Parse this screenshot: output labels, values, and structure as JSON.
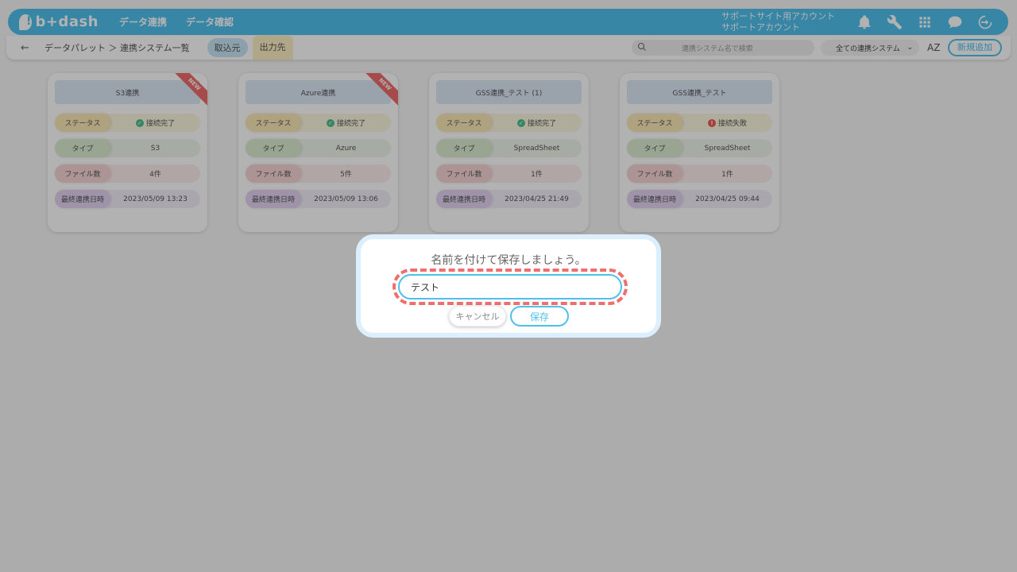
{
  "header": {
    "logo_text": "b+dash",
    "nav": [
      "データ連携",
      "データ確認"
    ],
    "account_line1": "サポートサイト用アカウント",
    "account_line2": "サポートアカウント",
    "accent_color": "#4fc0ee"
  },
  "subbar": {
    "back_icon": "←",
    "breadcrumb": "データパレット ＞ 連携システム一覧",
    "tab_source": "取込元",
    "tab_dest": "出力先",
    "search_placeholder": "連携システム名で検索",
    "filter_selected": "全ての連携システム",
    "sort_label": "AZ",
    "new_button": "新規追加"
  },
  "cards": [
    {
      "title": "S3連携",
      "badge": "NEW",
      "status_label": "ステータス",
      "status": "接続完了",
      "status_ok": true,
      "type_label": "タイプ",
      "type": "S3",
      "files_label": "ファイル数",
      "files": "4件",
      "date_label": "最終連携日時",
      "date": "2023/05/09 13:23"
    },
    {
      "title": "Azure連携",
      "badge": "NEW",
      "status_label": "ステータス",
      "status": "接続完了",
      "status_ok": true,
      "type_label": "タイプ",
      "type": "Azure",
      "files_label": "ファイル数",
      "files": "5件",
      "date_label": "最終連携日時",
      "date": "2023/05/09 13:06"
    },
    {
      "title": "GSS連携_テスト (1)",
      "badge": "",
      "status_label": "ステータス",
      "status": "接続完了",
      "status_ok": true,
      "type_label": "タイプ",
      "type": "SpreadSheet",
      "files_label": "ファイル数",
      "files": "1件",
      "date_label": "最終連携日時",
      "date": "2023/04/25 21:49"
    },
    {
      "title": "GSS連携_テスト",
      "badge": "",
      "status_label": "ステータス",
      "status": "接続失敗",
      "status_ok": false,
      "type_label": "タイプ",
      "type": "SpreadSheet",
      "files_label": "ファイル数",
      "files": "1件",
      "date_label": "最終連携日時",
      "date": "2023/04/25 09:44"
    }
  ],
  "dialog": {
    "title": "名前を付けて保存しましょう。",
    "input_value": "テスト",
    "cancel": "キャンセル",
    "save": "保存",
    "highlight_color": "#ef6f6f"
  }
}
